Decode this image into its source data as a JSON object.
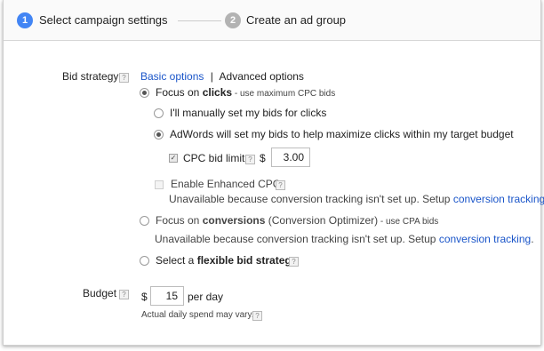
{
  "steps": [
    {
      "number": "1",
      "label": "Select campaign settings",
      "color": "#4285f4"
    },
    {
      "number": "2",
      "label": "Create an ad group",
      "color": "#b3b3b3"
    }
  ],
  "bid_strategy": {
    "label": "Bid strategy",
    "help": "?",
    "basic_options": "Basic options",
    "separator": "|",
    "advanced_options": "Advanced options",
    "focus_clicks": {
      "prefix": "Focus on ",
      "bold": "clicks",
      "suffix": " - use maximum CPC bids",
      "selected": true
    },
    "manual_bids": {
      "label": "I'll manually set my bids for clicks",
      "selected": false
    },
    "auto_bids": {
      "label": "AdWords will set my bids to help maximize clicks within my target budget",
      "selected": true
    },
    "cpc_limit": {
      "label": "CPC bid limit",
      "currency": "$",
      "value": "3.00",
      "checked": true
    },
    "enhanced_cpc": {
      "label": "Enable Enhanced CPC",
      "checked": false,
      "note": "Unavailable because conversion tracking isn't set up. Setup ",
      "link": "conversion tracking",
      "period": "."
    },
    "focus_conversions": {
      "prefix": "Focus on ",
      "bold": "conversions",
      "middle": " (Conversion Optimizer)",
      "suffix": " - use CPA bids",
      "selected": false,
      "note": "Unavailable because conversion tracking isn't set up. Setup ",
      "link": "conversion tracking",
      "period": "."
    },
    "flexible": {
      "prefix": "Select a ",
      "bold": "flexible bid strategy",
      "selected": false
    }
  },
  "budget": {
    "label": "Budget",
    "help": "?",
    "currency": "$",
    "value": "15",
    "unit": "per day",
    "note": "Actual daily spend may vary."
  }
}
